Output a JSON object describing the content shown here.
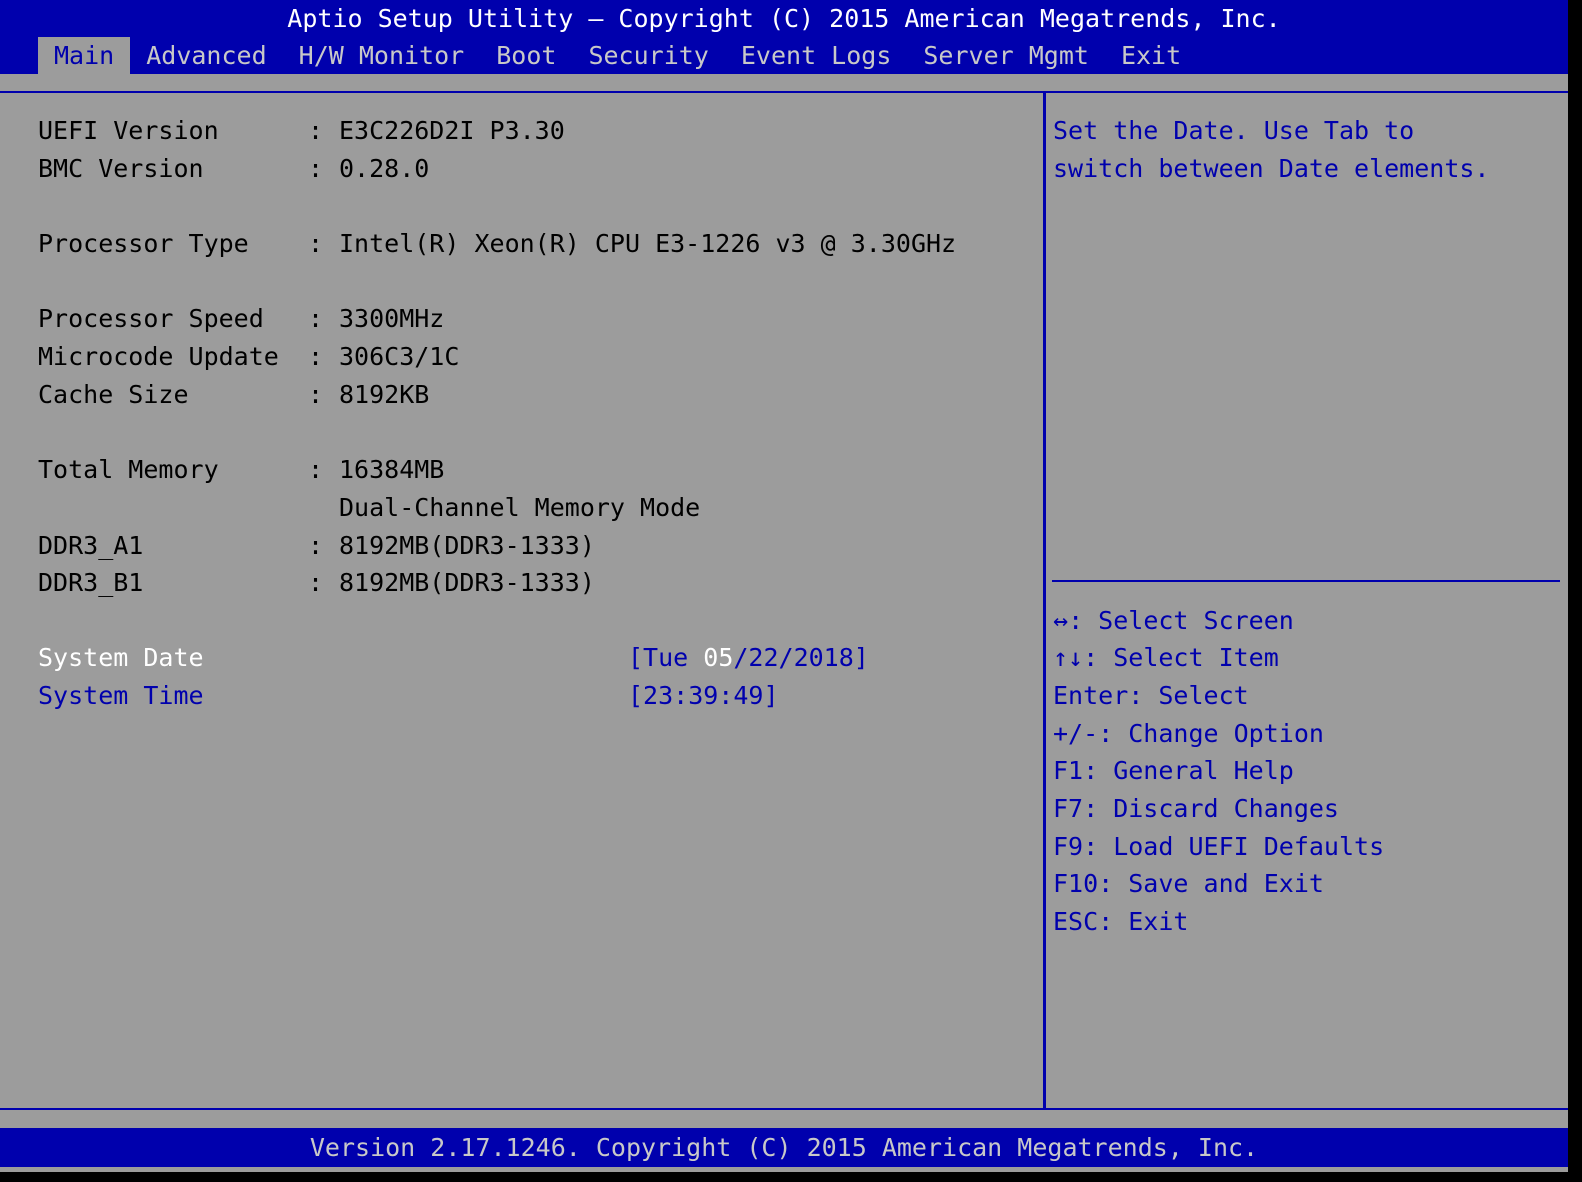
{
  "header": {
    "title": "Aptio Setup Utility – Copyright (C) 2015 American Megatrends, Inc.",
    "tabs": [
      {
        "label": "Main",
        "active": true
      },
      {
        "label": "Advanced"
      },
      {
        "label": "H/W Monitor"
      },
      {
        "label": "Boot"
      },
      {
        "label": "Security"
      },
      {
        "label": "Event Logs"
      },
      {
        "label": "Server Mgmt"
      },
      {
        "label": "Exit"
      }
    ]
  },
  "main": {
    "info": [
      {
        "label": "UEFI Version",
        "sep": ":",
        "value": "E3C226D2I P3.30"
      },
      {
        "label": "BMC Version",
        "sep": ":",
        "value": "0.28.0"
      },
      {
        "label": "Processor Type",
        "sep": ":",
        "value": "Intel(R) Xeon(R) CPU E3-1226 v3 @ 3.30GHz"
      },
      {
        "label": "Processor Speed",
        "sep": ":",
        "value": "3300MHz"
      },
      {
        "label": "Microcode Update",
        "sep": ":",
        "value": "306C3/1C"
      },
      {
        "label": "Cache Size",
        "sep": ":",
        "value": "8192KB"
      },
      {
        "label": "Total Memory",
        "sep": ":",
        "value": "16384MB"
      },
      {
        "label": "",
        "sep": "",
        "value": "Dual-Channel Memory Mode"
      },
      {
        "label": "DDR3_A1",
        "sep": ":",
        "value": "8192MB(DDR3-1333)"
      },
      {
        "label": "DDR3_B1",
        "sep": ":",
        "value": "8192MB(DDR3-1333)"
      }
    ],
    "system_date": {
      "label": "System Date",
      "value_prefix": "[Tue ",
      "value_selected": "05",
      "value_suffix": "/22/2018]"
    },
    "system_time": {
      "label": "System Time",
      "value": "[23:39:49]"
    }
  },
  "help": {
    "line1": "Set the Date. Use Tab to",
    "line2": "switch between Date elements."
  },
  "keys": [
    {
      "key": "↔",
      "text": ": Select Screen"
    },
    {
      "key": "↑↓",
      "text": ": Select Item"
    },
    {
      "key": "",
      "text": "Enter: Select"
    },
    {
      "key": "",
      "text": "+/-: Change Option"
    },
    {
      "key": "",
      "text": "F1: General Help"
    },
    {
      "key": "",
      "text": "F7: Discard Changes"
    },
    {
      "key": "",
      "text": "F9: Load UEFI Defaults"
    },
    {
      "key": "",
      "text": "F10: Save and Exit"
    },
    {
      "key": "",
      "text": "ESC: Exit"
    }
  ],
  "footer": {
    "text": "Version 2.17.1246. Copyright (C) 2015 American Megatrends, Inc."
  },
  "colors": {
    "background": "#9c9c9c",
    "accent_blue": "#0000ad",
    "highlight_white": "#ffffff",
    "inactive_tab": "#c8c8c8"
  }
}
